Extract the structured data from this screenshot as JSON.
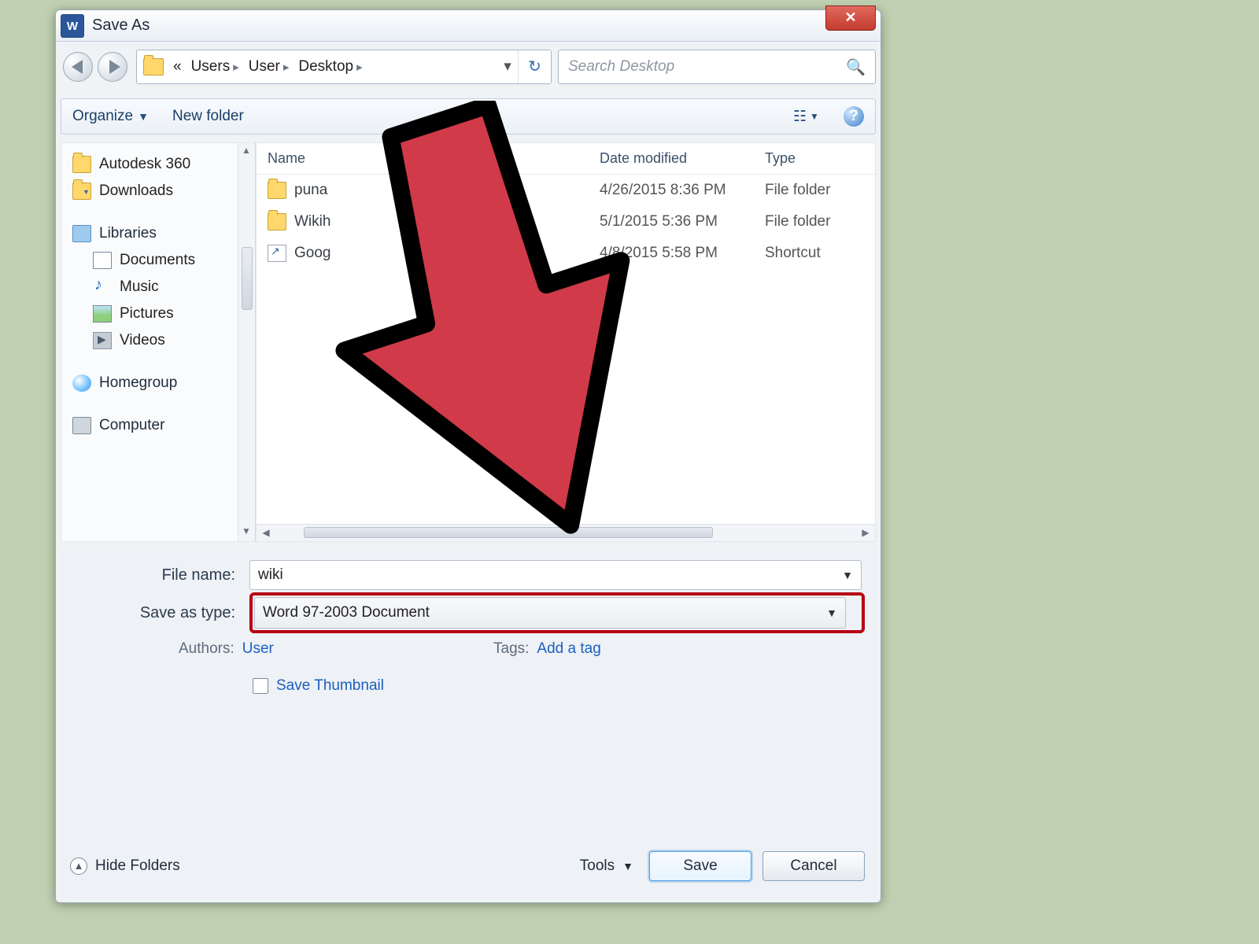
{
  "window": {
    "title": "Save As"
  },
  "breadcrumb": {
    "prefix": "«",
    "segs": [
      "Users",
      "User",
      "Desktop"
    ]
  },
  "search": {
    "placeholder": "Search Desktop"
  },
  "toolbar": {
    "organize": "Organize",
    "new_folder": "New folder"
  },
  "sidebar": {
    "items": [
      {
        "label": "Autodesk 360",
        "icon": "folder-y"
      },
      {
        "label": "Downloads",
        "icon": "folder-y dl"
      }
    ],
    "libraries_label": "Libraries",
    "libs": [
      {
        "label": "Documents",
        "icon": "doc"
      },
      {
        "label": "Music",
        "icon": "mus"
      },
      {
        "label": "Pictures",
        "icon": "pic"
      },
      {
        "label": "Videos",
        "icon": "vid"
      }
    ],
    "homegroup": "Homegroup",
    "computer": "Computer"
  },
  "columns": {
    "name": "Name",
    "date": "Date modified",
    "type": "Type"
  },
  "files": [
    {
      "name": "puna",
      "date": "4/26/2015 8:36 PM",
      "type": "File folder",
      "icon": "folder-y"
    },
    {
      "name": "Wikih",
      "date": "5/1/2015 5:36 PM",
      "type": "File folder",
      "icon": "folder-y"
    },
    {
      "name": "Goog",
      "date": "4/8/2015 5:58 PM",
      "type": "Shortcut",
      "icon": "sc"
    }
  ],
  "form": {
    "filename_label": "File name:",
    "filename_value": "wiki",
    "type_label": "Save as type:",
    "type_value": "Word 97-2003 Document"
  },
  "meta": {
    "authors_label": "Authors:",
    "authors_value": "User",
    "tags_label": "Tags:",
    "tags_value": "Add a tag"
  },
  "thumbnail_label": "Save Thumbnail",
  "footer": {
    "hide": "Hide Folders",
    "tools": "Tools",
    "save": "Save",
    "cancel": "Cancel"
  }
}
